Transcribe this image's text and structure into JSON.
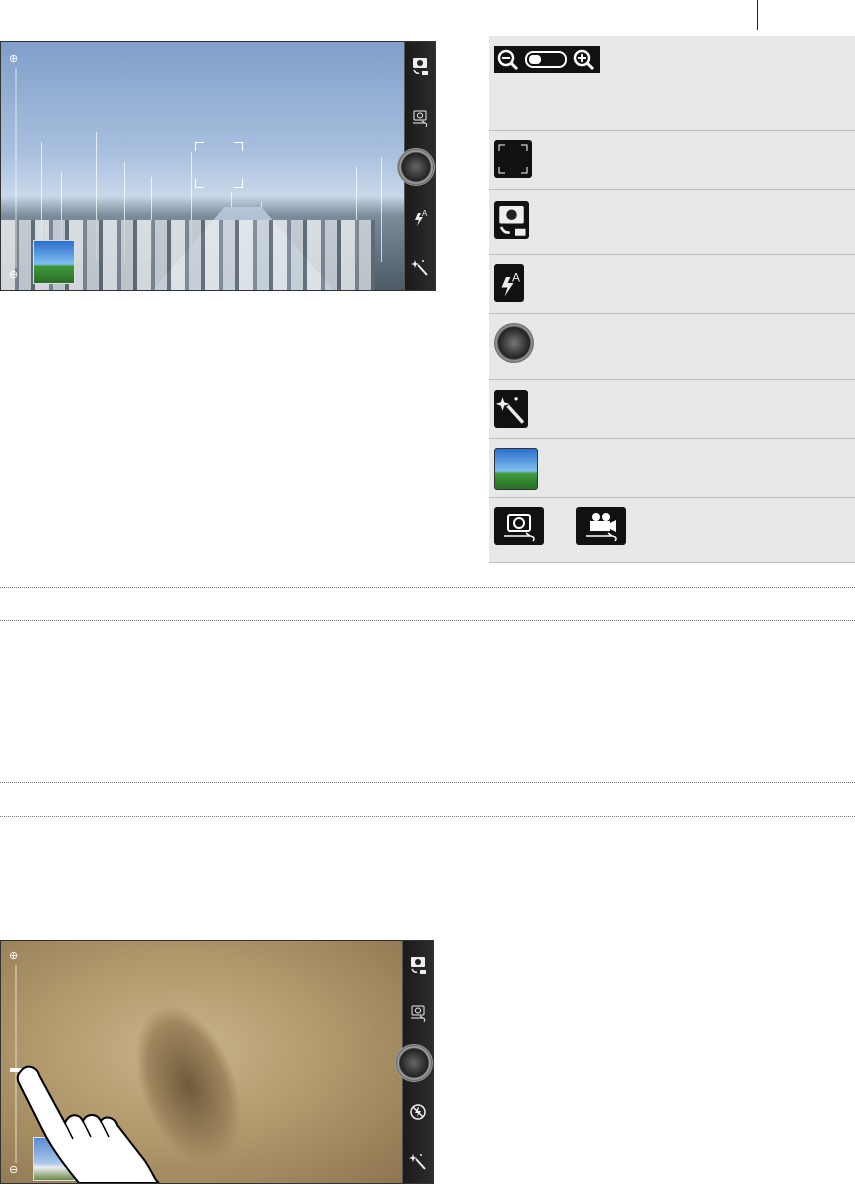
{
  "document": {
    "screenshot_1": {
      "icons": [
        "zoom-out-icon",
        "zoom-in-icon",
        "camera-share-icon",
        "switch-camera-icon",
        "shutter-icon",
        "flash-auto-icon",
        "effects-icon",
        "gallery-icon"
      ]
    },
    "icon_legend": {
      "rows": [
        {
          "icons": [
            "zoom-out-icon",
            "zoom-slider-icon",
            "zoom-in-icon"
          ]
        },
        {
          "icons": [
            "focus-frame-icon"
          ]
        },
        {
          "icons": [
            "camera-share-icon"
          ]
        },
        {
          "icons": [
            "flash-auto-icon"
          ]
        },
        {
          "icons": [
            "shutter-icon"
          ]
        },
        {
          "icons": [
            "effects-icon"
          ]
        },
        {
          "icons": [
            "gallery-icon"
          ]
        },
        {
          "icons": [
            "switch-camera-icon",
            "switch-video-icon"
          ]
        }
      ]
    },
    "screenshot_2": {
      "icons": [
        "zoom-in-icon",
        "zoom-out-icon",
        "camera-share-icon",
        "switch-camera-icon",
        "shutter-icon",
        "flash-off-icon",
        "effects-icon",
        "gallery-icon",
        "finger-gesture-icon"
      ]
    }
  }
}
